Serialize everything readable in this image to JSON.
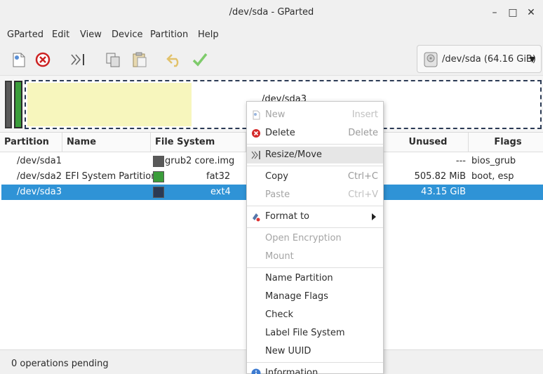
{
  "window": {
    "title": "/dev/sda - GParted",
    "minimize": "–",
    "maximize": "□",
    "close": "✕"
  },
  "menu": [
    "GParted",
    "Edit",
    "View",
    "Device",
    "Partition",
    "Help"
  ],
  "toolbar": {
    "icons": [
      "new-partition-icon",
      "delete-icon",
      "resize-move-icon",
      "copy-icon",
      "paste-icon",
      "undo-icon",
      "apply-icon"
    ],
    "device": "/dev/sda (64.16 GiB)"
  },
  "diskmap": {
    "selected_label": "/dev/sda3",
    "sda3_used_fraction": 0.32
  },
  "table": {
    "headers": [
      "Partition",
      "Name",
      "File System",
      "Unused",
      "Flags"
    ],
    "rows": [
      {
        "partition": "/dev/sda1",
        "name": "",
        "fs": "grub2 core.img",
        "fs_color": "#595959",
        "unused": "---",
        "flags": "bios_grub",
        "selected": false
      },
      {
        "partition": "/dev/sda2",
        "name": "EFI System Partition",
        "fs": "fat32",
        "fs_color": "#3b9d3b",
        "unused": "505.82 MiB",
        "flags": "boot, esp",
        "selected": false
      },
      {
        "partition": "/dev/sda3",
        "name": "",
        "fs": "ext4",
        "fs_color": "#2b3a54",
        "unused": "43.15 GiB",
        "flags": "",
        "selected": true
      }
    ]
  },
  "status": "0 operations pending",
  "context_menu": {
    "new": {
      "label": "New",
      "accel": "Insert"
    },
    "delete": {
      "label": "Delete",
      "accel": "Delete"
    },
    "resize_move": {
      "label": "Resize/Move"
    },
    "copy": {
      "label": "Copy",
      "accel": "Ctrl+C"
    },
    "paste": {
      "label": "Paste",
      "accel": "Ctrl+V"
    },
    "format_to": {
      "label": "Format to"
    },
    "open_encryption": {
      "label": "Open Encryption"
    },
    "mount": {
      "label": "Mount"
    },
    "name_partition": {
      "label": "Name Partition"
    },
    "manage_flags": {
      "label": "Manage Flags"
    },
    "check": {
      "label": "Check"
    },
    "label_fs": {
      "label": "Label File System"
    },
    "new_uuid": {
      "label": "New UUID"
    },
    "information": {
      "label": "Information"
    }
  }
}
